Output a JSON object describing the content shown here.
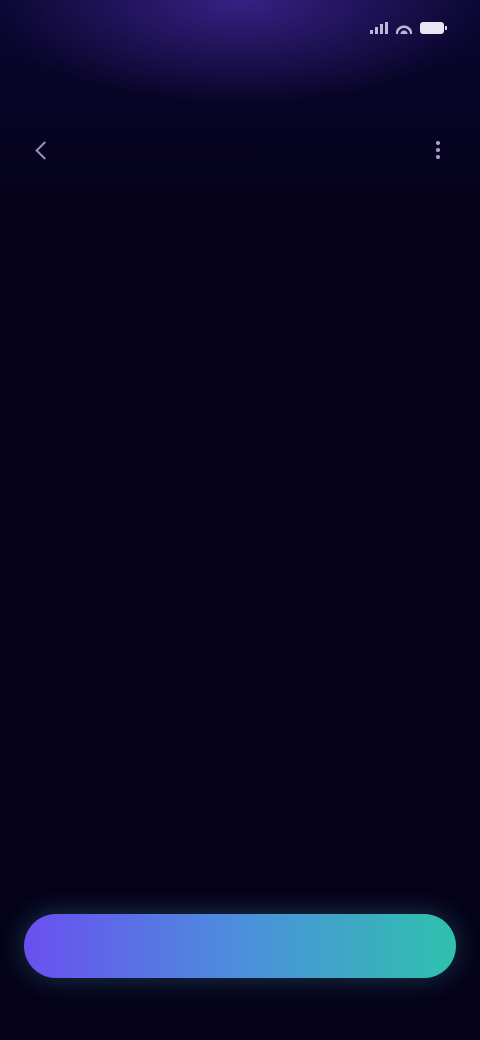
{
  "status_bar": {
    "time": "",
    "icons": [
      "signal-icon",
      "wifi-icon",
      "battery-icon"
    ]
  },
  "header": {
    "title": "",
    "back_icon": "chevron-left-icon",
    "more_icon": "more-vertical-icon"
  },
  "empty_state": {
    "title": "",
    "subtitle": ""
  },
  "footer": {
    "primary_button_label": ""
  },
  "colors": {
    "background": "#05021a",
    "header_glow": "#5a37c8",
    "button_gradient_start": "#6a4ff0",
    "button_gradient_mid": "#4c8fdd",
    "button_gradient_end": "#2fc1ad"
  }
}
